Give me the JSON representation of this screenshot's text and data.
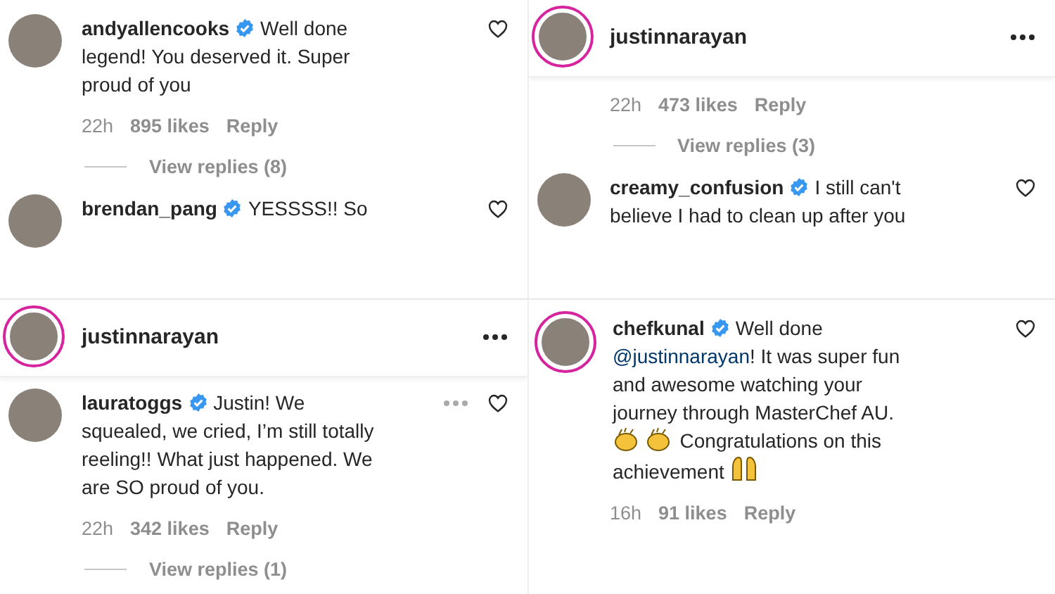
{
  "columns": [
    {
      "panels": [
        {
          "items": [
            {
              "kind": "comment",
              "username": "andyallencooks",
              "verified": true,
              "story_ring": false,
              "liked": false,
              "more": false,
              "body": [
                {
                  "kind": "text",
                  "text": "Well done legend! You deserved it. Super proud of you"
                }
              ]
            },
            {
              "kind": "meta",
              "time": "22h",
              "likes": "895 likes",
              "reply": "Reply"
            },
            {
              "kind": "view_replies",
              "label": "View replies (8)"
            },
            {
              "kind": "comment",
              "username": "brendan_pang",
              "verified": true,
              "story_ring": false,
              "liked": false,
              "more": false,
              "body": [
                {
                  "kind": "text",
                  "text": "YESSSS!! So"
                }
              ]
            }
          ]
        },
        {
          "items": [
            {
              "kind": "header",
              "username": "justinnarayan",
              "story_ring": true
            },
            {
              "kind": "comment",
              "username": "lauratoggs",
              "verified": true,
              "story_ring": false,
              "liked": false,
              "more": true,
              "body": [
                {
                  "kind": "text",
                  "text": "Justin! We squealed, we cried, I’m still totally reeling!! What just happened. We are SO proud of you."
                }
              ]
            },
            {
              "kind": "meta",
              "time": "22h",
              "likes": "342 likes",
              "reply": "Reply"
            },
            {
              "kind": "view_replies",
              "label": "View replies (1)"
            }
          ]
        }
      ]
    },
    {
      "panels": [
        {
          "items": [
            {
              "kind": "header",
              "username": "justinnarayan",
              "story_ring": true
            },
            {
              "kind": "meta",
              "time": "22h",
              "likes": "473 likes",
              "reply": "Reply"
            },
            {
              "kind": "view_replies",
              "label": "View replies (3)"
            },
            {
              "kind": "comment",
              "username": "creamy_confusion",
              "verified": true,
              "story_ring": false,
              "liked": false,
              "more": false,
              "body": [
                {
                  "kind": "text",
                  "text": "I still can't believe I had to clean up after you"
                }
              ]
            }
          ]
        },
        {
          "items": [
            {
              "kind": "comment",
              "username": "chefkunal",
              "verified": true,
              "story_ring": true,
              "liked": false,
              "more": false,
              "body": [
                {
                  "kind": "text",
                  "text": "Well done"
                },
                {
                  "kind": "mention",
                  "text": "@justinnarayan"
                },
                {
                  "kind": "text",
                  "text": "! It was super fun and awesome watching your journey through MasterChef AU."
                },
                {
                  "kind": "clap"
                },
                {
                  "kind": "clap"
                },
                {
                  "kind": "text",
                  "text": "Congratulations on this achievement"
                },
                {
                  "kind": "raised_hands"
                }
              ]
            },
            {
              "kind": "meta",
              "time": "16h",
              "likes": "91 likes",
              "reply": "Reply"
            }
          ]
        }
      ]
    }
  ]
}
